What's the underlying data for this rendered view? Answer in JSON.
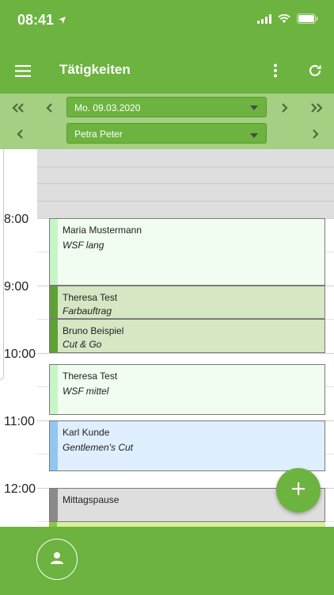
{
  "status": {
    "time": "08:41"
  },
  "header": {
    "title": "Tätigkeiten",
    "menu_icon": "menu-icon",
    "more_icon": "more-vert-icon",
    "refresh_icon": "refresh-icon"
  },
  "nav": {
    "date": "Mo. 09.03.2020",
    "employee": "Petra Peter"
  },
  "calendar": {
    "hours": [
      "8:00",
      "9:00",
      "10:00",
      "11:00",
      "12:00"
    ],
    "events": [
      {
        "name": "Maria Mustermann",
        "service": "WSF lang",
        "bg": "#f0fdf0",
        "stripe": "#c8f5c8"
      },
      {
        "name": "Theresa Test",
        "service": "Farbauftrag",
        "bg": "#d6e7c4",
        "stripe": "#5ea035"
      },
      {
        "name": "Bruno Beispiel",
        "service": "Cut & Go",
        "bg": "#d6e7c4",
        "stripe": "#5ea035"
      },
      {
        "name": "Theresa Test",
        "service": "WSF mittel",
        "bg": "#f0fdf0",
        "stripe": "#c8f5c8"
      },
      {
        "name": "Karl Kunde",
        "service": "Gentlemen's Cut",
        "bg": "#dfefff",
        "stripe": "#92c6f0"
      },
      {
        "name": "Mittagspause",
        "service": "",
        "bg": "#dedede",
        "stripe": "#8a8a8a"
      }
    ]
  },
  "colors": {
    "primary": "#6db33f",
    "nav_bg": "#a5cf82"
  },
  "fab": {
    "icon": "plus-icon"
  },
  "bottom": {
    "profile_icon": "person-icon"
  }
}
